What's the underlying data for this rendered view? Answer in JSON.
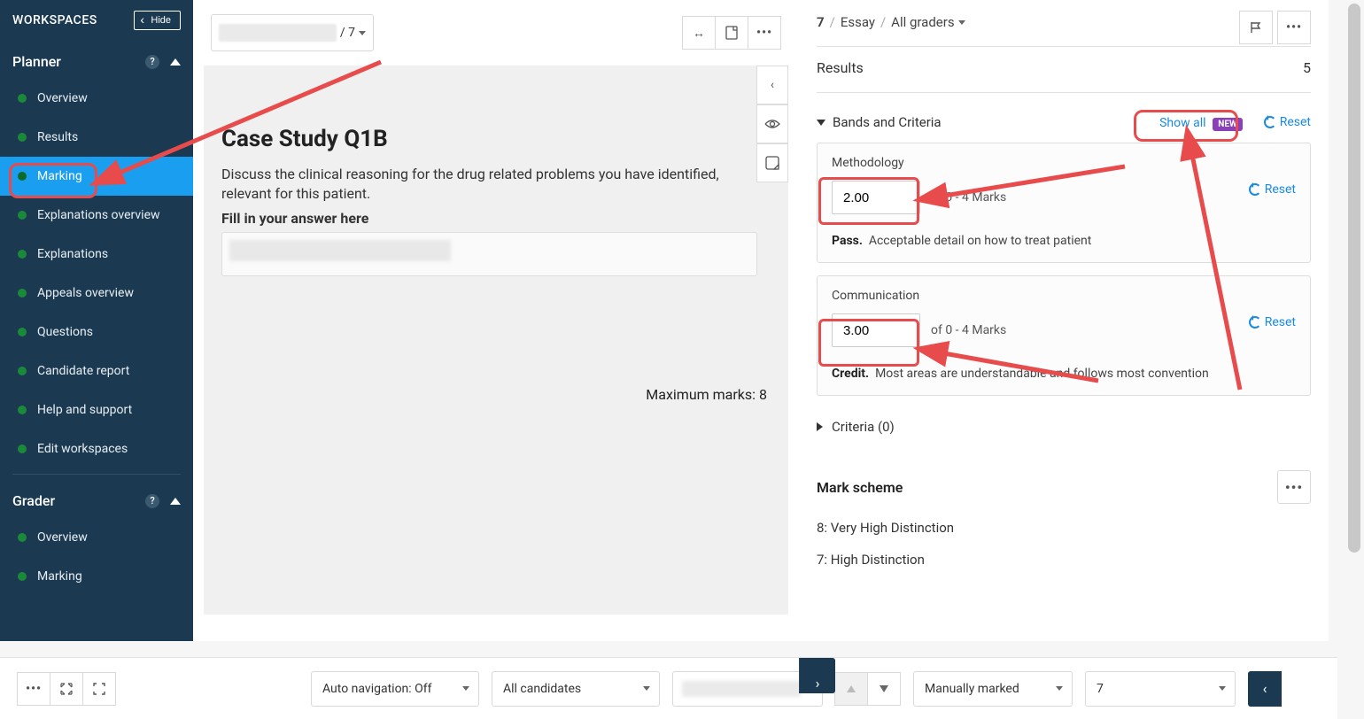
{
  "sidebar": {
    "title": "WORKSPACES",
    "hide": "Hide",
    "sections": [
      {
        "name": "Planner",
        "items": [
          {
            "label": "Overview"
          },
          {
            "label": "Results"
          },
          {
            "label": "Marking",
            "active": true
          },
          {
            "label": "Explanations overview"
          },
          {
            "label": "Explanations"
          },
          {
            "label": "Appeals overview"
          },
          {
            "label": "Questions"
          },
          {
            "label": "Candidate report"
          },
          {
            "label": "Help and support"
          },
          {
            "label": "Edit workspaces"
          }
        ]
      },
      {
        "name": "Grader",
        "items": [
          {
            "label": "Overview"
          },
          {
            "label": "Marking"
          }
        ]
      }
    ]
  },
  "mid": {
    "studentNum": "/ 7",
    "title": "Case Study Q1B",
    "prompt": "Discuss the clinical reasoning for the drug related problems you have identified, relevant for this patient.",
    "fill": "Fill in your answer here",
    "maxMarks": "Maximum marks: 8"
  },
  "right": {
    "crumb1": "7",
    "crumb2": "Essay",
    "crumb3": "All graders",
    "resultsLabel": "Results",
    "resultsValue": "5",
    "bandsLabel": "Bands and Criteria",
    "showAll": "Show all",
    "newBadge": "NEW",
    "reset": "Reset",
    "criteria": [
      {
        "name": "Methodology",
        "score": "2.00",
        "range": "of 0 - 4 Marks",
        "bandLabel": "Pass.",
        "bandDesc": "Acceptable detail on how to treat patient"
      },
      {
        "name": "Communication",
        "score": "3.00",
        "range": "of 0 - 4 Marks",
        "bandLabel": "Credit.",
        "bandDesc": "Most areas are understandable and follows most convention"
      }
    ],
    "criteriaCollapsed": "Criteria (0)",
    "markScheme": "Mark scheme",
    "schemeItems": [
      "8: Very High Distinction",
      "7: High Distinction"
    ]
  },
  "bottom": {
    "autoNav": "Auto navigation: Off",
    "allCand": "All candidates",
    "manual": "Manually marked",
    "seven": "7"
  }
}
